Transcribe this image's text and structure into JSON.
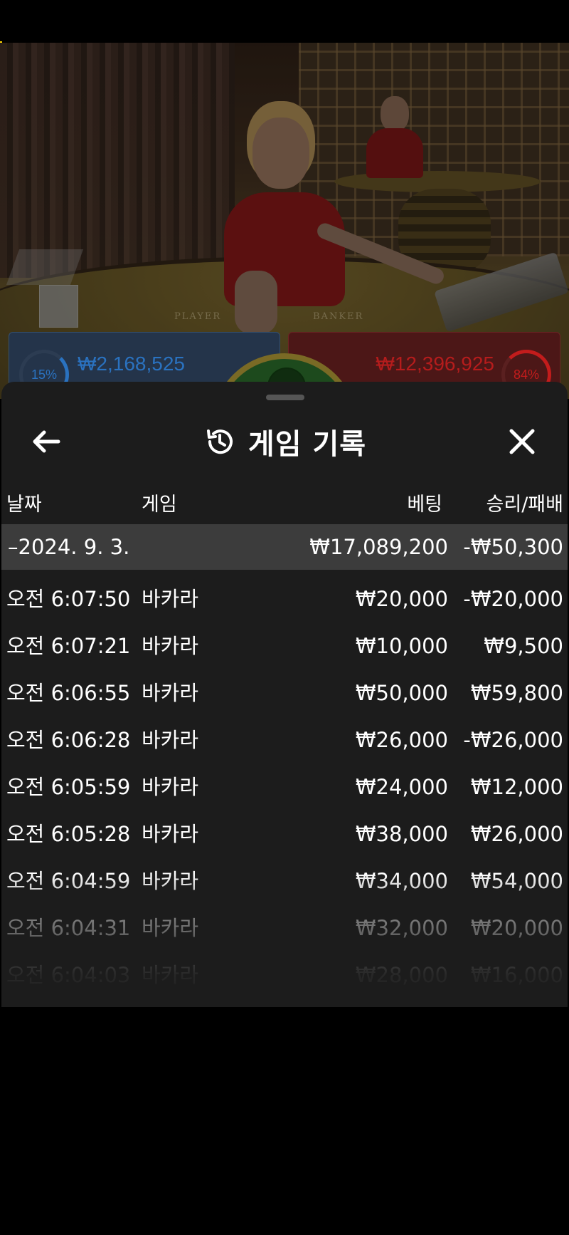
{
  "video": {
    "felt_labels": {
      "player": "PLAYER",
      "banker": "BANKER"
    }
  },
  "bet_bars": {
    "player": {
      "percent": "15%",
      "amount": "₩2,168,525",
      "color": "#2a72c0"
    },
    "banker": {
      "percent": "84%",
      "amount": "₩12,396,925",
      "color": "#c21c1c"
    }
  },
  "sheet": {
    "title": "게임 기록",
    "icons": {
      "back": "arrow-left-icon",
      "history": "history-icon",
      "close": "close-icon"
    },
    "columns": {
      "date": "날짜",
      "game": "게임",
      "bet": "베팅",
      "result": "승리/패배"
    },
    "date_group": {
      "date": "–2024. 9. 3.",
      "total_bet": "₩17,089,200",
      "total_result": "-₩50,300"
    },
    "rows": [
      {
        "time": "오전 6:07:50",
        "game": "바카라",
        "bet": "₩20,000",
        "result": "-₩20,000"
      },
      {
        "time": "오전 6:07:21",
        "game": "바카라",
        "bet": "₩10,000",
        "result": "₩9,500"
      },
      {
        "time": "오전 6:06:55",
        "game": "바카라",
        "bet": "₩50,000",
        "result": "₩59,800"
      },
      {
        "time": "오전 6:06:28",
        "game": "바카라",
        "bet": "₩26,000",
        "result": "-₩26,000"
      },
      {
        "time": "오전 6:05:59",
        "game": "바카라",
        "bet": "₩24,000",
        "result": "₩12,000"
      },
      {
        "time": "오전 6:05:28",
        "game": "바카라",
        "bet": "₩38,000",
        "result": "₩26,000"
      },
      {
        "time": "오전 6:04:59",
        "game": "바카라",
        "bet": "₩34,000",
        "result": "₩54,000"
      },
      {
        "time": "오전 6:04:31",
        "game": "바카라",
        "bet": "₩32,000",
        "result": "₩20,000"
      },
      {
        "time": "오전 6:04:03",
        "game": "바카라",
        "bet": "₩28,000",
        "result": "₩16,000"
      }
    ]
  }
}
